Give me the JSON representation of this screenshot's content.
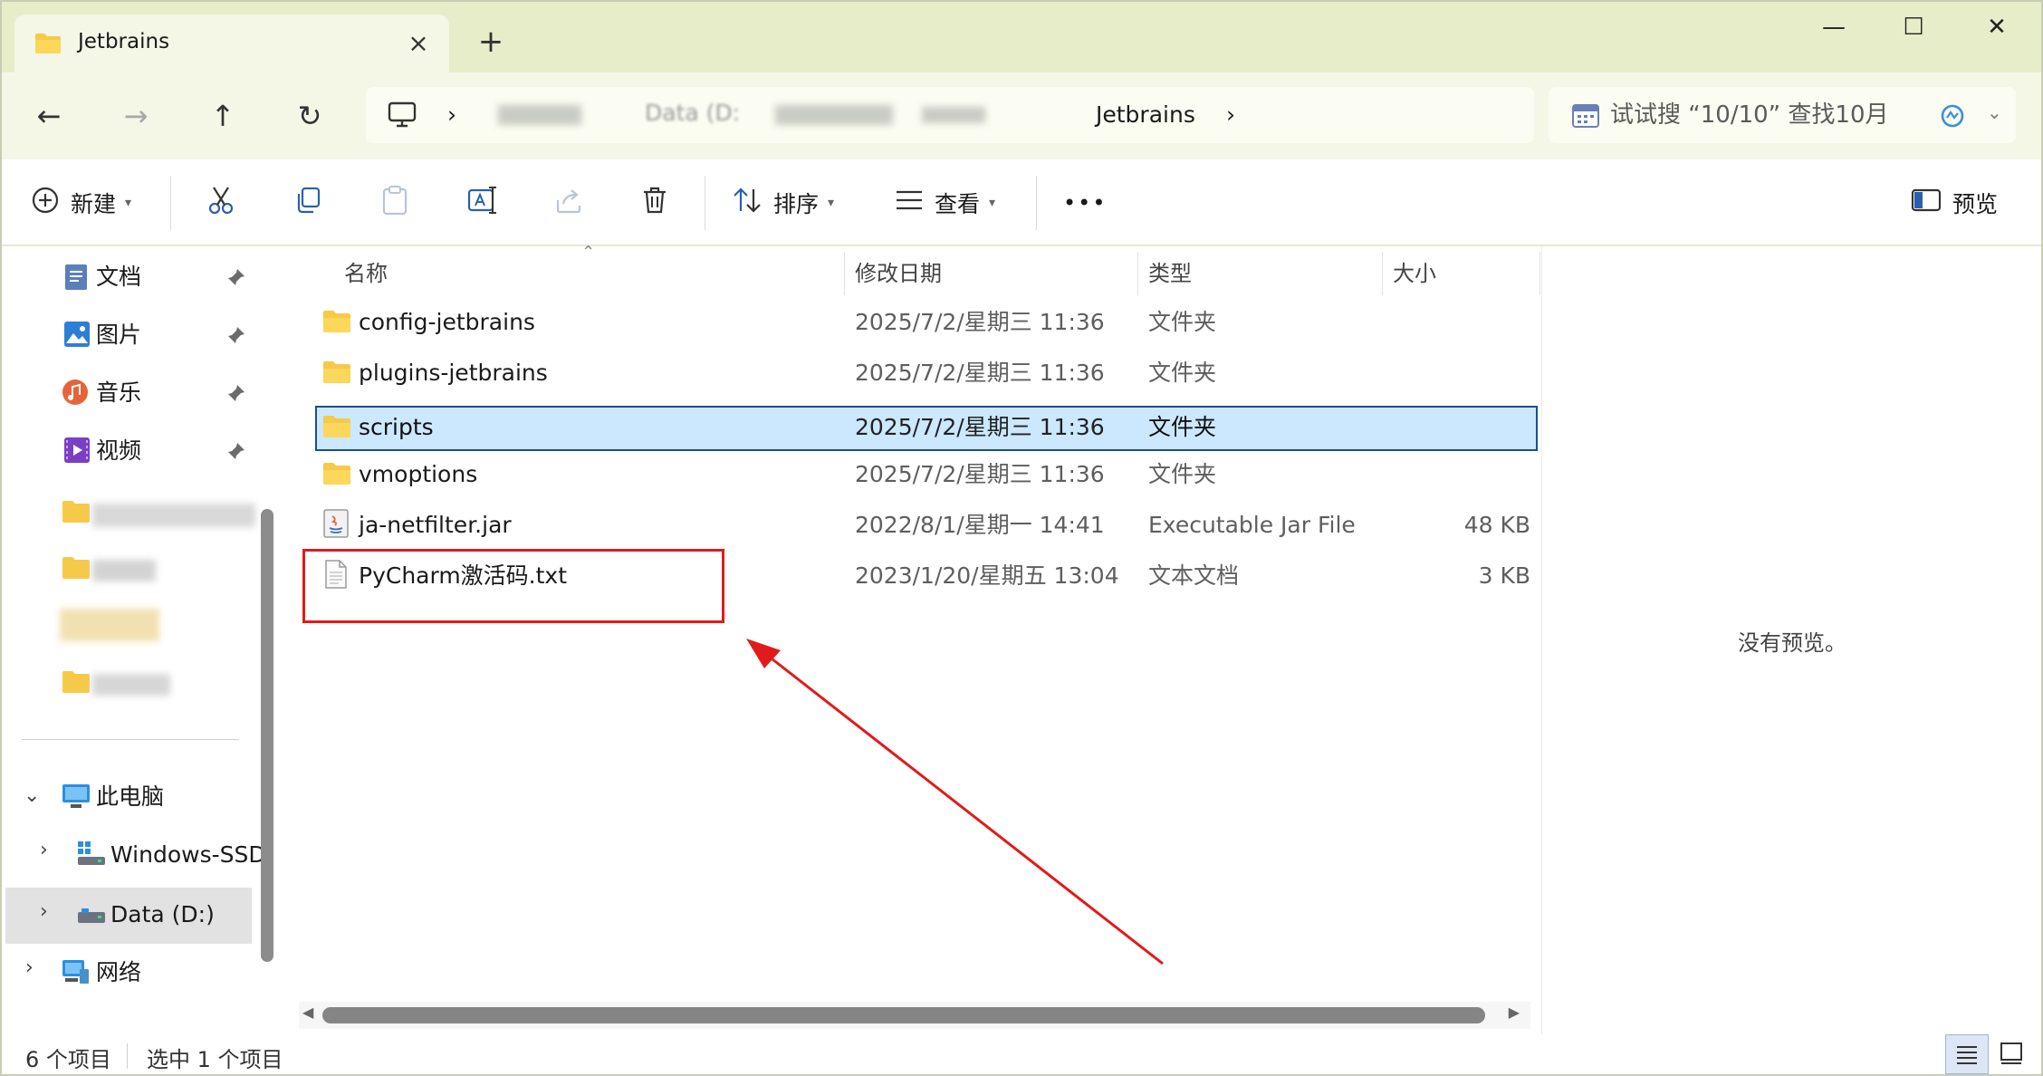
{
  "window": {
    "tab_title": "Jetbrains",
    "close_tab_glyph": "×",
    "new_tab_glyph": "+",
    "minimize_glyph": "—",
    "maximize_glyph": "☐",
    "close_glyph": "✕"
  },
  "nav": {
    "back_glyph": "←",
    "forward_glyph": "→",
    "up_glyph": "↑",
    "refresh_glyph": "↻"
  },
  "address": {
    "separator": "›",
    "visible_fragment": "Data (D:",
    "current_folder": "Jetbrains"
  },
  "search": {
    "placeholder": "试试搜 “10/10” 查找10月"
  },
  "commands": {
    "new": "新建",
    "sort": "排序",
    "view": "查看",
    "more": "•••",
    "preview": "预览"
  },
  "sidebar": {
    "pinned": [
      {
        "label": "文档",
        "icon": "documents-icon"
      },
      {
        "label": "图片",
        "icon": "pictures-icon"
      },
      {
        "label": "音乐",
        "icon": "music-icon"
      },
      {
        "label": "视频",
        "icon": "videos-icon"
      }
    ],
    "this_pc": "此电脑",
    "drives": [
      {
        "label": "Windows-SSD"
      },
      {
        "label": "Data (D:)"
      }
    ],
    "network": "网络"
  },
  "columns": {
    "name": "名称",
    "modified": "修改日期",
    "type": "类型",
    "size": "大小"
  },
  "files": [
    {
      "name": "config-jetbrains",
      "date": "2025/7/2/星期三 11:36",
      "type": "文件夹",
      "size": "",
      "icon": "folder-icon"
    },
    {
      "name": "plugins-jetbrains",
      "date": "2025/7/2/星期三 11:36",
      "type": "文件夹",
      "size": "",
      "icon": "folder-icon"
    },
    {
      "name": "scripts",
      "date": "2025/7/2/星期三 11:36",
      "type": "文件夹",
      "size": "",
      "icon": "folder-icon",
      "selected": true
    },
    {
      "name": "vmoptions",
      "date": "2025/7/2/星期三 11:36",
      "type": "文件夹",
      "size": "",
      "icon": "folder-icon"
    },
    {
      "name": "ja-netfilter.jar",
      "date": "2022/8/1/星期一 14:41",
      "type": "Executable Jar File",
      "size": "48 KB",
      "icon": "java-jar-icon"
    },
    {
      "name": "PyCharm激活码.txt",
      "date": "2023/1/20/星期五 13:04",
      "type": "文本文档",
      "size": "3 KB",
      "icon": "text-file-icon"
    }
  ],
  "preview_pane": {
    "message": "没有预览。"
  },
  "status": {
    "item_count": "6 个项目",
    "selection": "选中 1 个项目"
  },
  "colors": {
    "titlebar": "#e6edc8",
    "selection": "#cce8ff",
    "annotation": "#e11b1b",
    "folder": "#f7c948"
  }
}
